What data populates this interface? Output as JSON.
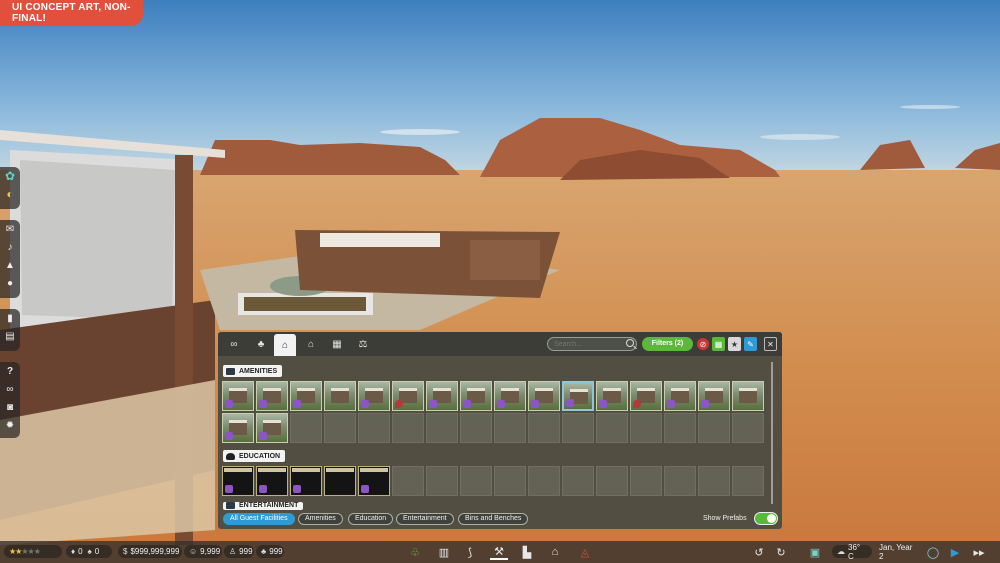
{
  "banner": {
    "text": "UI CONCEPT ART, NON-FINAL!"
  },
  "left_toolbar": {
    "group1": [
      "molecule-icon",
      "dino-coin-icon"
    ],
    "group2": [
      "mail-icon",
      "bell-icon",
      "warning-icon",
      "record-icon"
    ],
    "group3": [
      "mouse-icon",
      "book-icon"
    ],
    "group4": [
      "help-icon",
      "link-icon",
      "camera-icon",
      "settings-icon"
    ]
  },
  "panel": {
    "tabs": [
      "infinity-tab-icon",
      "palm-tab-icon",
      "facility-tab-icon",
      "shelter-tab-icon",
      "map-tab-icon",
      "balance-tab-icon"
    ],
    "active_tab": 2,
    "search": {
      "placeholder": "Search..."
    },
    "filters_label": "Filters (2)",
    "sections": {
      "amenities": {
        "title": "AMENITIES",
        "items": 18
      },
      "education": {
        "title": "EDUCATION",
        "items": 5
      },
      "entertainment": {
        "title": "ENTERTAINMENT"
      }
    },
    "categories": [
      "All Guest Facilities",
      "Amenities",
      "Education",
      "Entertainment",
      "Bins and Benches"
    ],
    "active_category": 0,
    "show_prefabs": {
      "label": "Show Prefabs",
      "value": true
    }
  },
  "bottom_bar": {
    "rating_stars": 2,
    "rating_max": 5,
    "stat_a": "0",
    "stat_b": "0",
    "money": "$999,999,999",
    "guests": "9,999",
    "staff": "999",
    "plants": "999",
    "temperature": "36° C",
    "date": "Jan, Year 2"
  },
  "colors": {
    "accent_green": "#5cb83a",
    "accent_blue": "#2f9bd6",
    "banner_red": "#e0503c"
  }
}
